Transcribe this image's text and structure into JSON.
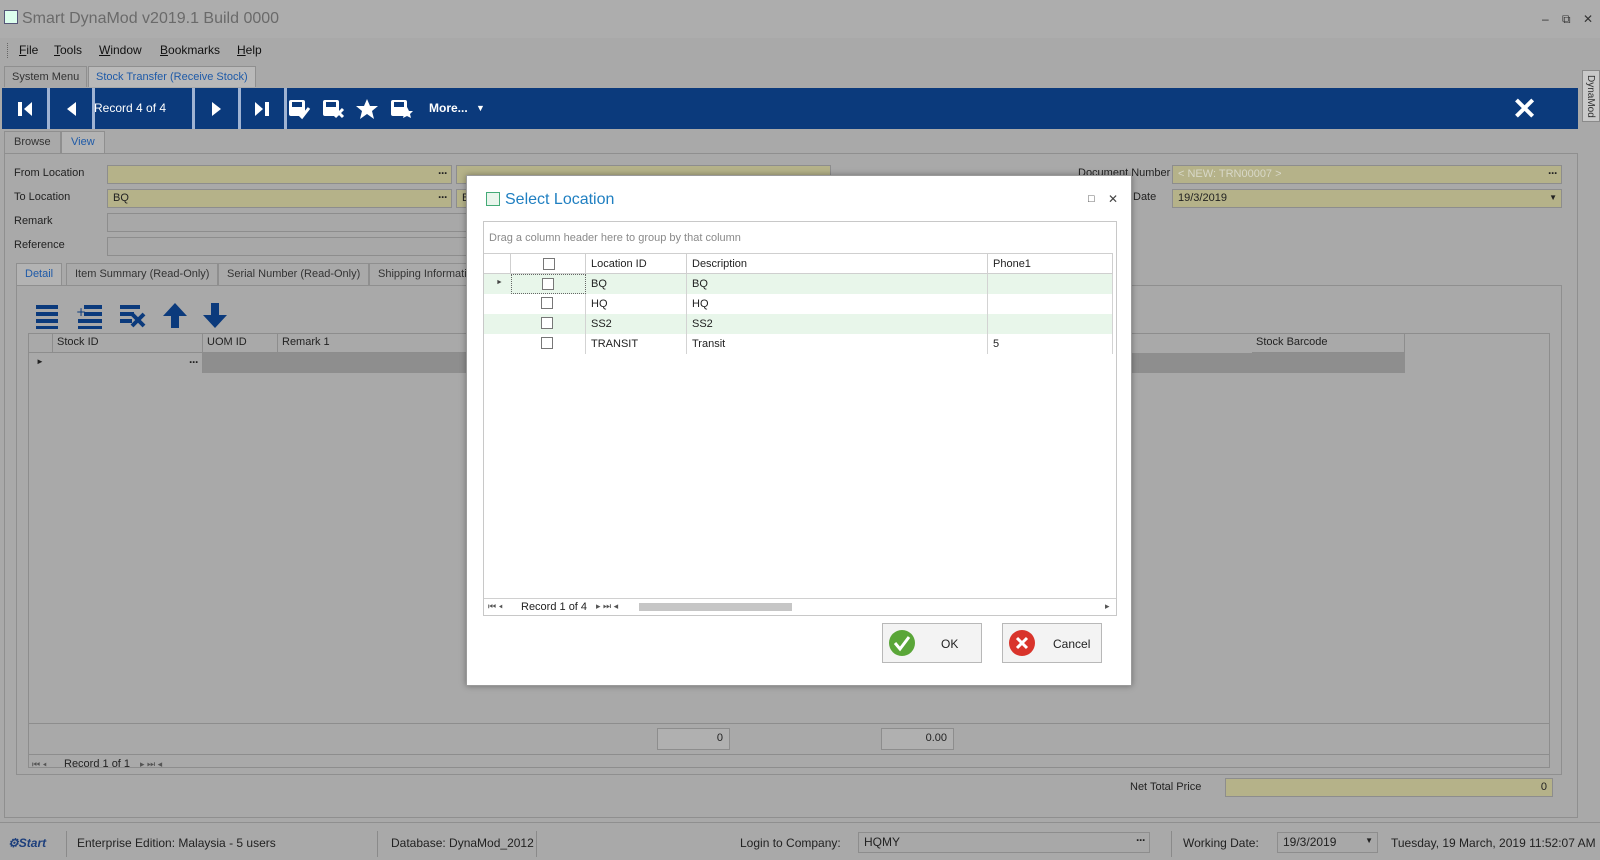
{
  "app": {
    "title": "Smart DynaMod v2019.1 Build 0000"
  },
  "window_controls": {
    "minimize": "–",
    "restore": "⧉",
    "close": "✕"
  },
  "menu": [
    "File",
    "Tools",
    "Window",
    "Bookmarks",
    "Help"
  ],
  "doc_tabs": [
    "System Menu",
    "Stock Transfer (Receive Stock)"
  ],
  "toolbar": {
    "record_label": "Record 4 of 4",
    "more_label": "More...",
    "close_glyph": "✕"
  },
  "side_tab": "DynaMod",
  "view_tabs": [
    "Browse",
    "View"
  ],
  "form": {
    "from_location_label": "From Location",
    "from_location_value": "",
    "to_location_label": "To Location",
    "to_location_value": "BQ",
    "to_location_desc": "B",
    "remark_label": "Remark",
    "reference_label": "Reference",
    "document_number_label": "Document Number",
    "document_number_value": "< NEW: TRN00007 >",
    "date_label": "Date",
    "date_value": "19/3/2019"
  },
  "sub_tabs": [
    "Detail",
    "Item Summary (Read-Only)",
    "Serial Number (Read-Only)",
    "Shipping Informati"
  ],
  "detail_grid": {
    "columns": [
      "Stock ID",
      "UOM ID",
      "Remark 1",
      "Stock Barcode"
    ],
    "total_qty": "0",
    "total_amount": "0.00",
    "nav_record": "Record 1 of 1"
  },
  "net_total": {
    "label": "Net Total Price",
    "value": "0"
  },
  "status_bar": {
    "start": "Start",
    "edition": "Enterprise Edition: Malaysia - 5 users",
    "database": "Database: DynaMod_2012",
    "login_label": "Login to Company:",
    "company": "HQMY",
    "working_date_label": "Working Date:",
    "working_date": "19/3/2019",
    "datetime": "Tuesday, 19 March, 2019 11:52:07 AM"
  },
  "modal": {
    "title": "Select Location",
    "group_hint": "Drag a column header here to group by that column",
    "columns": [
      "Location ID",
      "Description",
      "Phone1"
    ],
    "rows": [
      {
        "id": "BQ",
        "description": "BQ",
        "phone": ""
      },
      {
        "id": "HQ",
        "description": "HQ",
        "phone": ""
      },
      {
        "id": "SS2",
        "description": "SS2",
        "phone": ""
      },
      {
        "id": "TRANSIT",
        "description": "Transit",
        "phone": "5"
      }
    ],
    "nav_record": "Record 1 of 4",
    "ok_label": "OK",
    "cancel_label": "Cancel"
  }
}
